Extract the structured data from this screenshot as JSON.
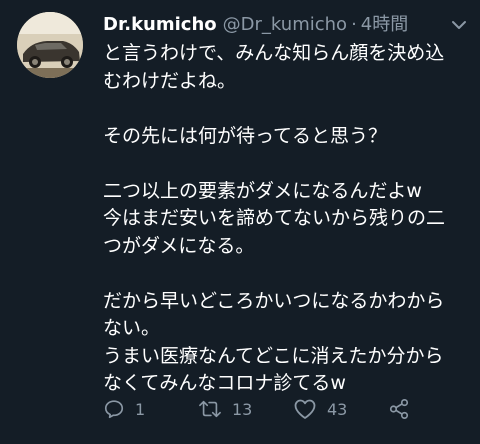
{
  "tweet": {
    "display_name": "Dr.kumicho",
    "handle": "@Dr_kumicho",
    "separator": "·",
    "time": "4時間",
    "lines": [
      "と言うわけで、みんな知らん顔を決め込",
      "むわけだよね。",
      "",
      "その先には何が待ってると思う？",
      "",
      "二つ以上の要素がダメになるんだよw",
      "今はまだ安いを諦めてないから残りの二",
      "つがダメになる。",
      "",
      "だから早いどころかいつになるかわから",
      "ない。",
      "うまい医療なんてどこに消えたか分から",
      "なくてみんなコロナ診てるw"
    ]
  },
  "actions": {
    "reply_count": "1",
    "retweet_count": "13",
    "like_count": "43"
  },
  "icons": {
    "avatar": "car-photo-avatar",
    "menu": "chevron-down-icon",
    "reply": "reply-icon",
    "retweet": "retweet-icon",
    "like": "heart-icon",
    "share": "share-icon"
  },
  "colors": {
    "background": "#141d26",
    "text": "#ffffff",
    "secondary": "#8b98a5"
  }
}
